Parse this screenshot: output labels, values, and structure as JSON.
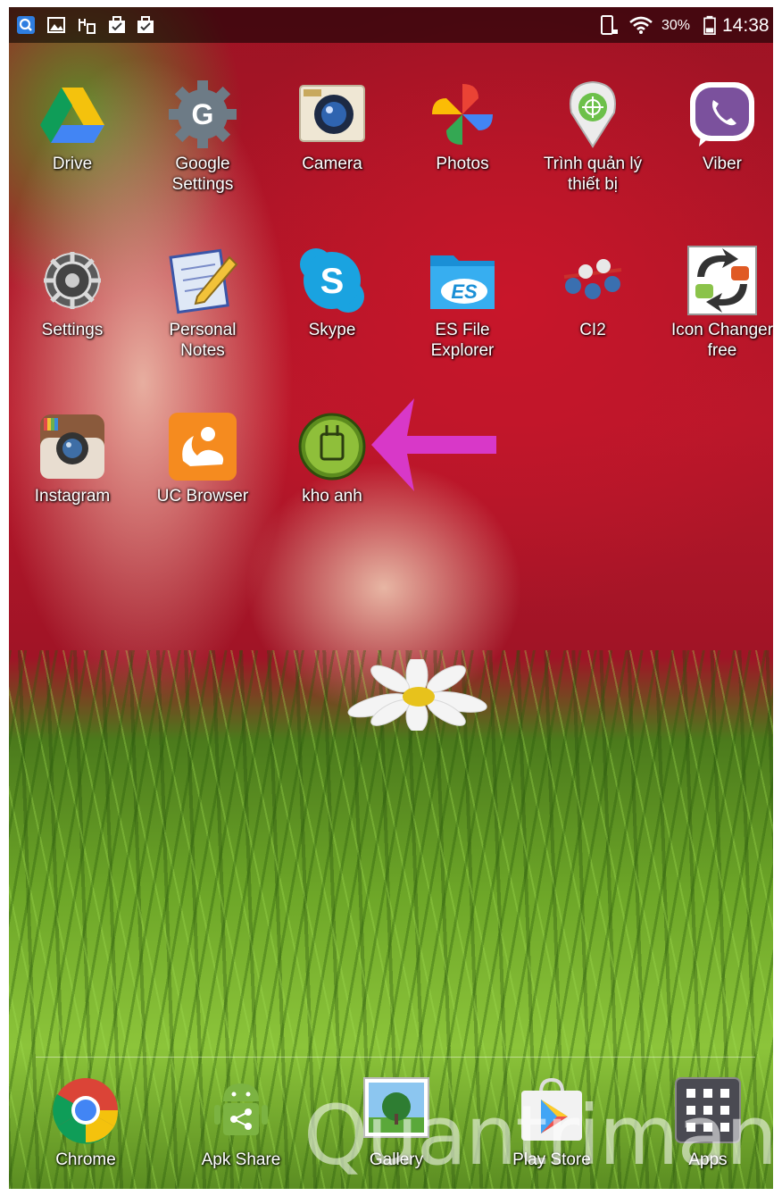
{
  "status_bar": {
    "battery_percent": "30%",
    "time": "14:38",
    "left_icons": [
      "search-icon",
      "image-icon",
      "usb-debug-icon",
      "briefcase-check-icon",
      "briefcase-alert-icon"
    ],
    "right_icons": [
      "phone-icon",
      "wifi-icon",
      "battery-icon"
    ]
  },
  "home_apps": [
    {
      "label": "Drive",
      "icon": "drive-icon"
    },
    {
      "label": "Google\nSettings",
      "icon": "google-settings-icon"
    },
    {
      "label": "Camera",
      "icon": "camera-icon"
    },
    {
      "label": "Photos",
      "icon": "photos-icon"
    },
    {
      "label": "Trình quản lý\nthiết bị",
      "icon": "device-manager-icon"
    },
    {
      "label": "Viber",
      "icon": "viber-icon"
    },
    {
      "label": "Settings",
      "icon": "settings-icon"
    },
    {
      "label": "Personal\nNotes",
      "icon": "personal-notes-icon"
    },
    {
      "label": "Skype",
      "icon": "skype-icon"
    },
    {
      "label": "ES File\nExplorer",
      "icon": "es-file-explorer-icon"
    },
    {
      "label": "CI2",
      "icon": "ci2-icon"
    },
    {
      "label": "Icon Changer\nfree",
      "icon": "icon-changer-icon"
    },
    {
      "label": "Instagram",
      "icon": "instagram-icon"
    },
    {
      "label": "UC Browser",
      "icon": "uc-browser-icon"
    },
    {
      "label": "kho anh",
      "icon": "kho-anh-icon"
    }
  ],
  "dock_apps": [
    {
      "label": "Chrome",
      "icon": "chrome-icon"
    },
    {
      "label": "Apk Share",
      "icon": "apk-share-icon"
    },
    {
      "label": "Gallery",
      "icon": "gallery-icon"
    },
    {
      "label": "Play Store",
      "icon": "play-store-icon"
    },
    {
      "label": "Apps",
      "icon": "apps-grid-icon"
    }
  ],
  "annotation": {
    "icon": "arrow-left-icon",
    "color": "#d838c8"
  },
  "watermark": "Quantrimang",
  "colors": {
    "status_bar_bg": "#000000",
    "label_text": "#ffffff"
  }
}
